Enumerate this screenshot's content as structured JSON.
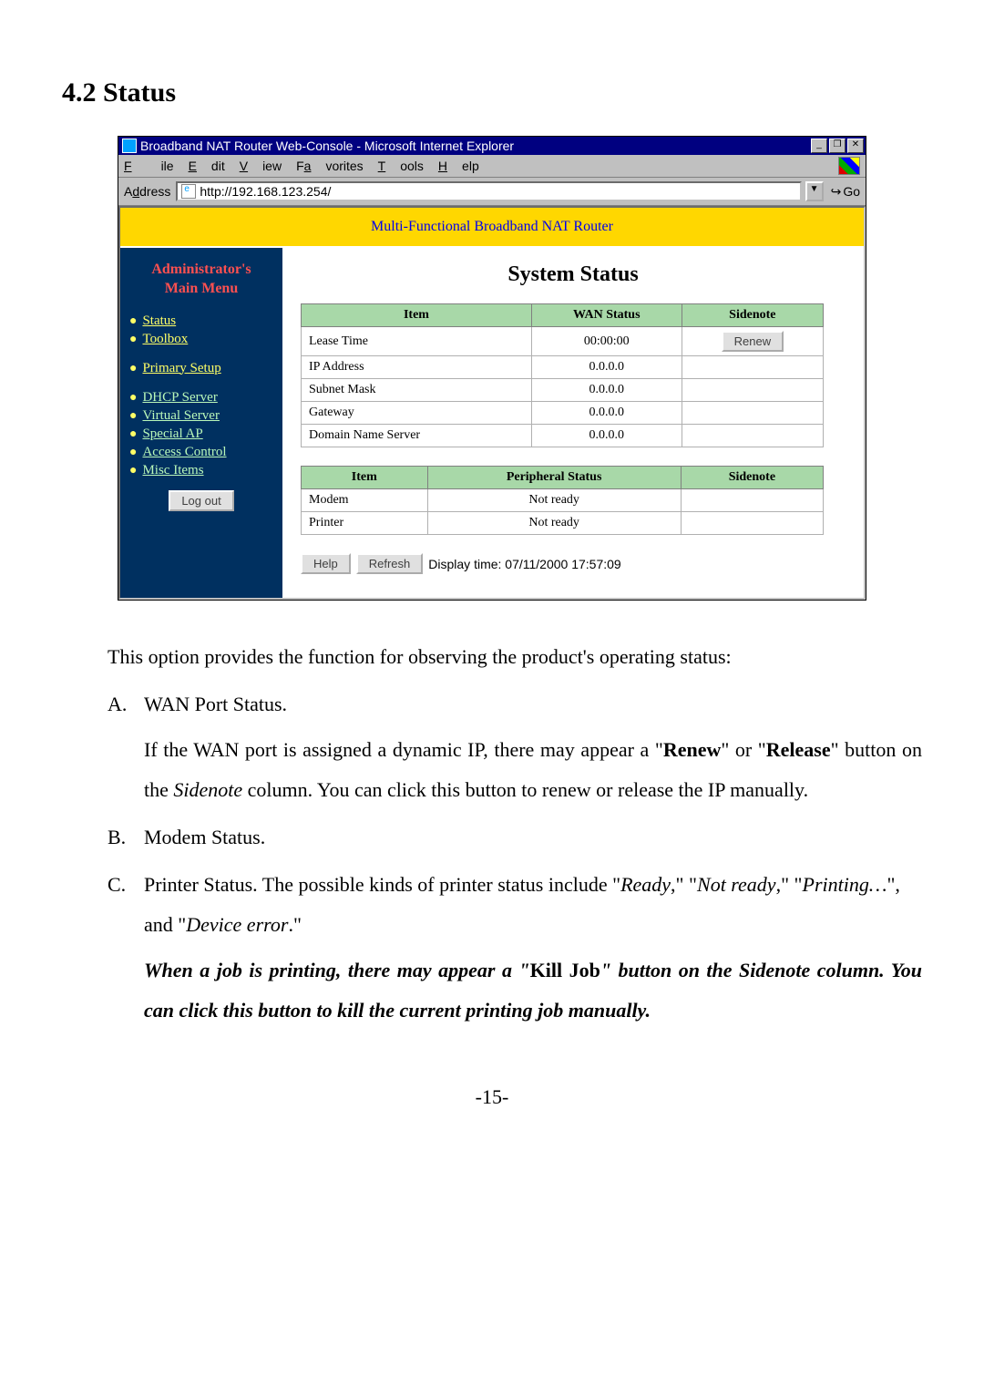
{
  "heading": "4.2 Status",
  "window": {
    "title": "Broadband NAT Router Web-Console - Microsoft Internet Explorer",
    "min": "_",
    "restore": "❐",
    "close": "✕",
    "menu": {
      "file": "File",
      "edit": "Edit",
      "view": "View",
      "favorites": "Favorites",
      "tools": "Tools",
      "help": "Help"
    },
    "address_label": "Address",
    "url": "http://192.168.123.254/",
    "dd": "▼",
    "go_icon": "↪",
    "go": "Go"
  },
  "router": {
    "banner": "Multi-Functional Broadband NAT Router",
    "admin_title_l1": "Administrator's",
    "admin_title_l2": "Main Menu",
    "menu_g1": [
      "Status",
      "Toolbox"
    ],
    "menu_g2": [
      "Primary Setup"
    ],
    "menu_g3": [
      "DHCP Server",
      "Virtual Server",
      "Special AP",
      "Access Control",
      "Misc Items"
    ],
    "logout": "Log out",
    "content_title": "System Status",
    "t1_headers": [
      "Item",
      "WAN Status",
      "Sidenote"
    ],
    "t1_rows": [
      {
        "item": "Lease Time",
        "val": "00:00:00",
        "side_btn": "Renew"
      },
      {
        "item": "IP Address",
        "val": "0.0.0.0",
        "side": ""
      },
      {
        "item": "Subnet Mask",
        "val": "0.0.0.0",
        "side": ""
      },
      {
        "item": "Gateway",
        "val": "0.0.0.0",
        "side": ""
      },
      {
        "item": "Domain Name Server",
        "val": "0.0.0.0",
        "side": ""
      }
    ],
    "t2_headers": [
      "Item",
      "Peripheral Status",
      "Sidenote"
    ],
    "t2_rows": [
      {
        "item": "Modem",
        "val": "Not ready",
        "side": ""
      },
      {
        "item": "Printer",
        "val": "Not ready",
        "side": ""
      }
    ],
    "help_btn": "Help",
    "refresh_btn": "Refresh",
    "display_time": "Display time: 07/11/2000 17:57:09"
  },
  "doc": {
    "intro": "This option provides the function for observing the product's operating status:",
    "a_marker": "A.",
    "a_title": "WAN Port Status.",
    "a_body_1": "If the WAN port is assigned a dynamic IP, there may appear a \"",
    "a_bold1": "Renew",
    "a_body_2": "\" or \"",
    "a_bold2": "Release",
    "a_body_3": "\" button on the ",
    "a_it": "Sidenote",
    "a_body_4": " column. You can click this button to renew or release the IP manually.",
    "b_marker": "B.",
    "b_title": "Modem Status.",
    "c_marker": "C.",
    "c_body_1": "Printer Status. The possible kinds of printer status include \"",
    "c_it1": "Ready",
    "c_body_2": ",\" \"",
    "c_it2": "Not ready",
    "c_body_3": ",\" \"",
    "c_it3": "Printing…",
    "c_body_4": "\", and \"",
    "c_it4": "Device error",
    "c_body_5": ".\"",
    "c_kill_1": "When a job is printing, there may appear a \"",
    "c_kill_bold": "Kill Job",
    "c_kill_2": "\" button on the Sidenote column. You can click this button to kill the current printing job manually.",
    "page": "-15-"
  }
}
